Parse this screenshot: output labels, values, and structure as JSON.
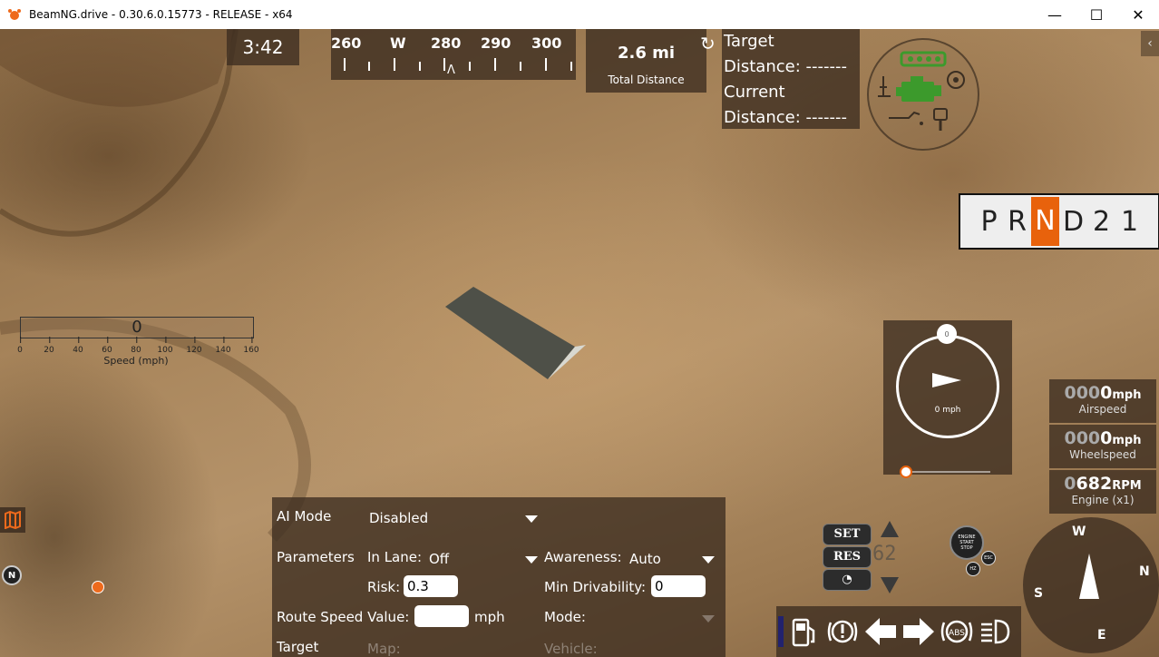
{
  "window": {
    "title": "BeamNG.drive - 0.30.6.0.15773 - RELEASE - x64",
    "minimize": "—",
    "maximize": "☐",
    "close": "✕"
  },
  "hud": {
    "clock": "3:42",
    "compass": {
      "labels": [
        "260",
        "W",
        "280",
        "290",
        "300"
      ],
      "pointer": "Λ"
    },
    "total_distance": {
      "value": "2.6 mi",
      "label": "Total Distance"
    },
    "navigation": {
      "target_label": "Target",
      "target_distance": "Distance: -------",
      "current_label": "Current",
      "current_distance": "Distance: -------"
    },
    "gear_selector": {
      "gears": [
        "P",
        "R",
        "N",
        "D",
        "2",
        "1"
      ],
      "active": "N",
      "active_color": "#e8620c"
    },
    "speed_bar": {
      "value": "0",
      "ticks": [
        "0",
        "20",
        "40",
        "60",
        "80",
        "100",
        "120",
        "140",
        "160"
      ],
      "label": "Speed (mph)"
    },
    "speed_gauge": {
      "knob": "0",
      "readout": "0 mph"
    },
    "readouts": [
      {
        "dim": "000",
        "bright": "0",
        "unit": "mph",
        "label": "Airspeed"
      },
      {
        "dim": "000",
        "bright": "0",
        "unit": "mph",
        "label": "Wheelspeed"
      },
      {
        "dim": "0",
        "bright": "682",
        "unit": "RPM",
        "label": "Engine (x1)"
      }
    ],
    "cruise": {
      "set": "SET",
      "res": "RES",
      "display": "62"
    },
    "start_stop": {
      "line1": "ENGINE",
      "line2": "START",
      "line3": "STOP"
    },
    "small_buttons": {
      "esc": "ESC",
      "hz": "HZ"
    },
    "big_compass": {
      "w": "W",
      "n": "N",
      "e": "E",
      "s": "S"
    },
    "map_marker": "N"
  },
  "ai_panel": {
    "mode_label": "AI Mode",
    "mode_value": "Disabled",
    "parameters_label": "Parameters",
    "in_lane_label": "In Lane:",
    "in_lane_value": "Off",
    "awareness_label": "Awareness:",
    "awareness_value": "Auto",
    "risk_label": "Risk:",
    "risk_value": "0.3",
    "min_drivability_label": "Min Drivability:",
    "min_drivability_value": "0",
    "route_speed_label": "Route Speed Value:",
    "route_speed_value": "",
    "route_speed_unit": "mph",
    "mode2_label": "Mode:",
    "target_label": "Target",
    "map_label": "Map:",
    "vehicle_label": "Vehicle:"
  }
}
